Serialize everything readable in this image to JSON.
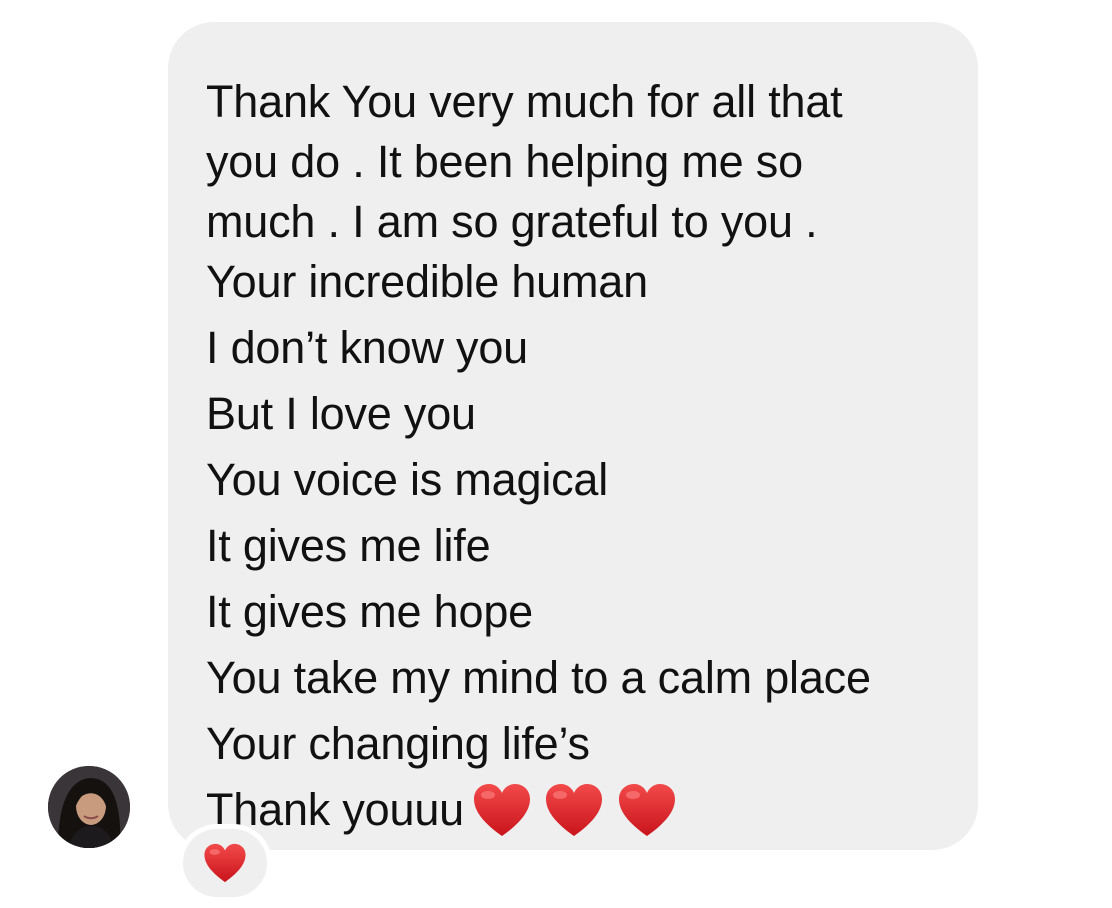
{
  "message": {
    "lines": [
      "Thank You very much for all that",
      "you do . It been helping me so",
      "much . I am so grateful to you .",
      "Your incredible human",
      "I don’t know you",
      "But I love you",
      "You voice is magical",
      "It gives me life",
      "It gives me hope",
      "You take my mind to a calm place",
      "Your changing life’s",
      "Thank youuu"
    ],
    "trailing_emoji": [
      "red-heart",
      "red-heart",
      "red-heart"
    ]
  },
  "reaction": {
    "emoji": "red-heart"
  },
  "colors": {
    "bubble_background": "#efefef",
    "text": "#111111",
    "heart": "#e0242b"
  }
}
